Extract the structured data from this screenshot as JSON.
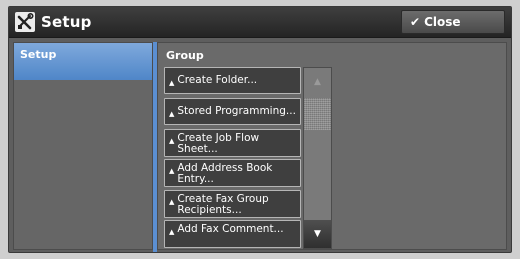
{
  "window": {
    "title": "Setup",
    "title_icon": "setup-tools-icon"
  },
  "toolbar": {
    "close_label": "Close",
    "close_icon": "check-icon"
  },
  "sidebar": {
    "tab_label": "Setup"
  },
  "group": {
    "label": "Group",
    "items": [
      {
        "label": "Create Folder..."
      },
      {
        "label": "Stored Programming..."
      },
      {
        "label": "Create Job Flow Sheet..."
      },
      {
        "label": "Add Address Book Entry..."
      },
      {
        "label": "Create Fax Group Recipients..."
      },
      {
        "label": "Add Fax Comment..."
      }
    ]
  },
  "scrollbar": {
    "up_icon": "triangle-up-icon",
    "down_icon": "triangle-down-icon"
  },
  "colors": {
    "accent": "#5b8fd2",
    "panel": "#6a6a6a",
    "titlebar": "#2c2c2c"
  }
}
